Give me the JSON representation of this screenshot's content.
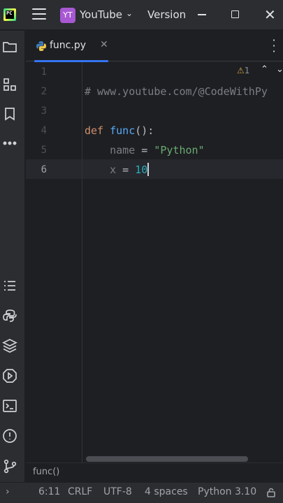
{
  "titlebar": {
    "logo_text": "PC",
    "project_badge": "YT",
    "project_name": "YouTube",
    "vcs_label": "Version"
  },
  "toolstrip": {
    "top_icons": [
      "folder-icon",
      "structure-icon",
      "bookmark-icon",
      "more-icon"
    ],
    "bottom_icons": [
      "todo-icon",
      "python-console-icon",
      "packages-icon",
      "services-icon",
      "terminal-icon",
      "problems-icon",
      "git-icon"
    ]
  },
  "tabs": [
    {
      "label": "func.py",
      "icon": "python-file-icon",
      "active": true
    }
  ],
  "editor": {
    "inspection_count": "1",
    "lines": [
      {
        "number": "1"
      },
      {
        "number": "2",
        "comment": "# www.youtube.com/@CodeWithPy"
      },
      {
        "number": "3"
      },
      {
        "number": "4",
        "keyword": "def",
        "func_name": "func",
        "tail": "():"
      },
      {
        "number": "5",
        "indent": "    ",
        "var": "name",
        "op": " = ",
        "string": "\"Python\""
      },
      {
        "number": "6",
        "indent": "    ",
        "var": "x",
        "op": " = ",
        "number_value": "10"
      }
    ],
    "active_line": 6
  },
  "breadcrumb": "func()",
  "statusbar": {
    "expand": "›",
    "position": "6:11",
    "line_separator": "CRLF",
    "encoding": "UTF-8",
    "indent": "4 spaces",
    "interpreter": "Python 3.10"
  },
  "colors": {
    "background": "#1e1f22",
    "panel": "#2b2d30",
    "accent": "#3574f0",
    "keyword": "#cf8e6d",
    "function": "#56a8f5",
    "string": "#6aab73",
    "number": "#2aacb8",
    "comment": "#7a7e85"
  }
}
